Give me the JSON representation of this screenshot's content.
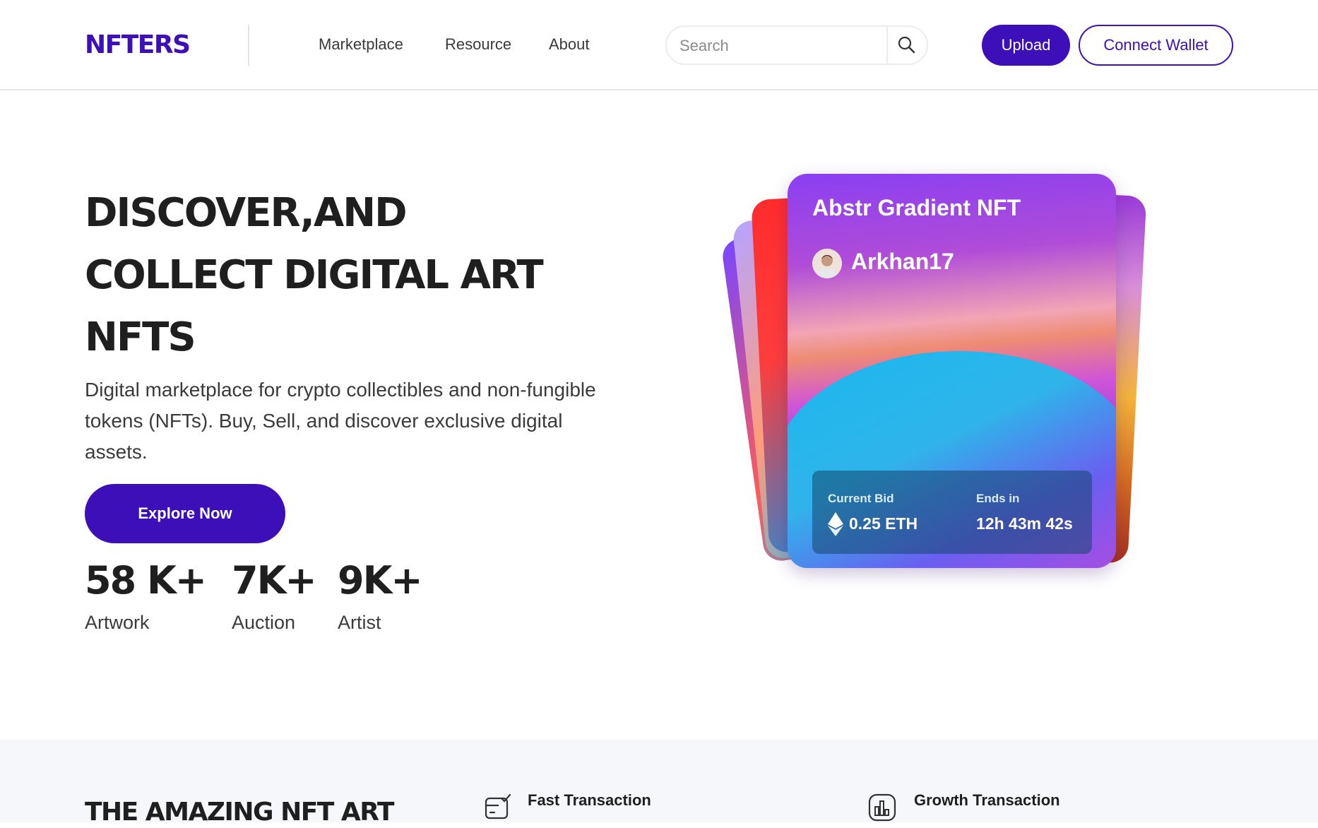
{
  "brand": {
    "logo": "NFTERS",
    "accent_color": "#3d0fb8"
  },
  "nav": {
    "items": [
      "Marketplace",
      "Resource",
      "About"
    ]
  },
  "search": {
    "placeholder": "Search",
    "value": "",
    "icon": "search-icon"
  },
  "header_actions": {
    "upload_label": "Upload",
    "connect_label": "Connect Wallet"
  },
  "hero": {
    "title_lines": [
      "DISCOVER,AND",
      "COLLECT DIGITAL ART",
      "NFTS"
    ],
    "description": "Digital marketplace for crypto collectibles and non-fungible tokens (NFTs). Buy, Sell, and discover exclusive digital assets.",
    "cta_label": "Explore Now",
    "stats": [
      {
        "value": "58 K+",
        "label": "Artwork"
      },
      {
        "value": "7K+",
        "label": "Auction"
      },
      {
        "value": "9K+",
        "label": "Artist"
      }
    ]
  },
  "featured_card": {
    "title": "Abstr Gradient NFT",
    "author": "Arkhan17",
    "current_bid_label": "Current Bid",
    "current_bid_value": "0.25 ETH",
    "ends_in_label": "Ends in",
    "ends_in_value": "12h 43m 42s"
  },
  "section": {
    "title": "THE AMAZING NFT ART",
    "features": [
      {
        "title": "Fast Transaction",
        "icon": "transaction-icon"
      },
      {
        "title": "Growth Transaction",
        "icon": "growth-chart-icon"
      }
    ]
  }
}
